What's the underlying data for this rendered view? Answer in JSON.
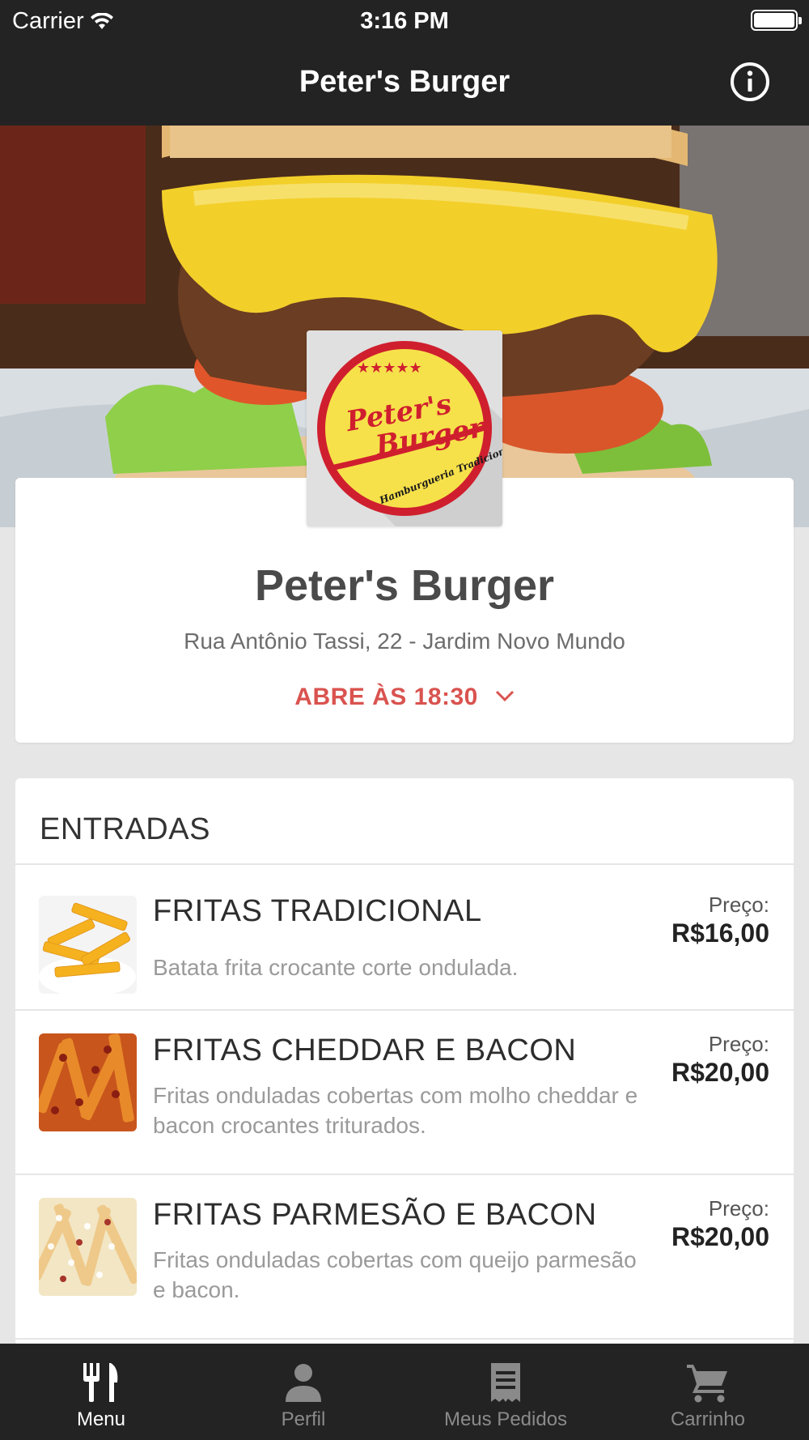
{
  "status_bar": {
    "carrier": "Carrier",
    "time": "3:16 PM"
  },
  "nav": {
    "title": "Peter's Burger",
    "info_icon": "info-icon"
  },
  "restaurant": {
    "name": "Peter's Burger",
    "address": "Rua Antônio Tassi, 22 - Jardim Novo Mundo",
    "hours": "ABRE ÀS 18:30",
    "logo_text_1": "Peter's",
    "logo_text_2": "Burger",
    "logo_text_3": "Hamburgueria Tradicional"
  },
  "colors": {
    "accent": "#d9534f",
    "dark": "#232323",
    "logo_red": "#cf1f2e",
    "logo_yellow": "#f6e14a"
  },
  "menu": {
    "section_title": "ENTRADAS",
    "items": [
      {
        "name": "FRITAS TRADICIONAL",
        "description": "Batata frita crocante corte ondulada.",
        "price_label": "Preço:",
        "price": "R$16,00"
      },
      {
        "name": "FRITAS CHEDDAR E BACON",
        "description": "Fritas onduladas cobertas com molho cheddar e bacon crocantes triturados.",
        "price_label": "Preço:",
        "price": "R$20,00"
      },
      {
        "name": "FRITAS PARMESÃO E BACON",
        "description": "Fritas onduladas cobertas com queijo parmesão  e bacon.",
        "price_label": "Preço:",
        "price": "R$20,00"
      }
    ]
  },
  "tabs": [
    {
      "label": "Menu",
      "icon": "fork-knife-icon",
      "active": true
    },
    {
      "label": "Perfil",
      "icon": "person-icon",
      "active": false
    },
    {
      "label": "Meus Pedidos",
      "icon": "receipt-icon",
      "active": false
    },
    {
      "label": "Carrinho",
      "icon": "cart-icon",
      "active": false
    }
  ]
}
